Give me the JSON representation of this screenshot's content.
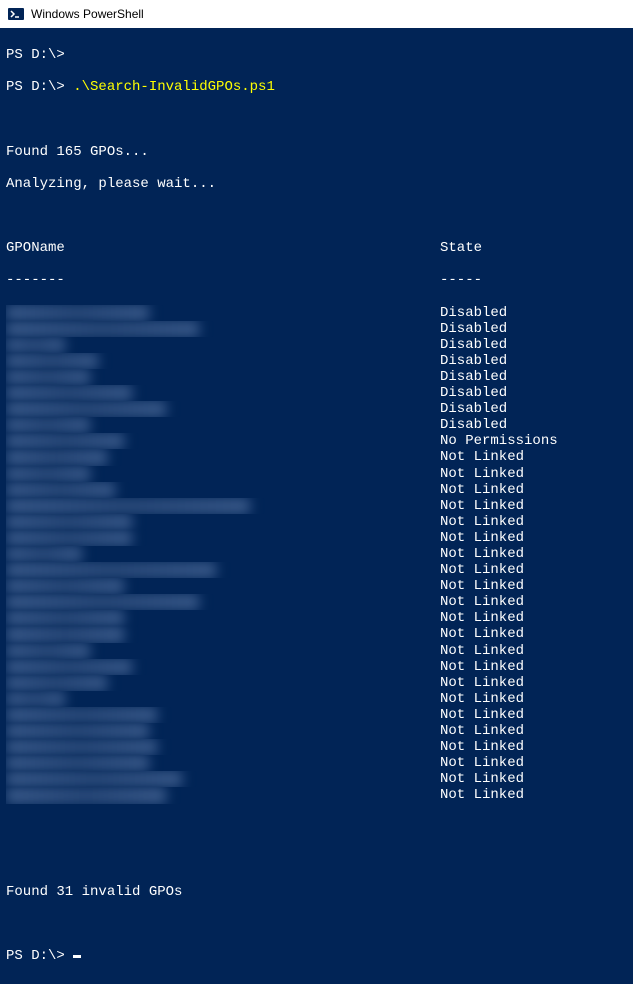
{
  "window": {
    "title": "Windows PowerShell"
  },
  "lines": {
    "prompt1_path": "PS D:\\>",
    "prompt2_path": "PS D:\\>",
    "command": ".\\Search-InvalidGPOs.ps1",
    "found": "Found 165 GPOs...",
    "analyzing": "Analyzing, please wait...",
    "header_name": "GPOName",
    "header_state": "State",
    "divider_name": "-------",
    "divider_state": "-----",
    "summary": "Found 31 invalid GPOs",
    "prompt3_path": "PS D:\\>"
  },
  "rows": [
    {
      "name_stub": "xxxxxx xxxxx xxxx",
      "state": "Disabled"
    },
    {
      "name_stub": "xxxxxxxxxx xxxx xxxxxxx",
      "state": "Disabled"
    },
    {
      "name_stub": "xx xxxx",
      "state": "Disabled"
    },
    {
      "name_stub": "xxx xxxxxxx",
      "state": "Disabled"
    },
    {
      "name_stub": "xxxx xxxxx",
      "state": "Disabled"
    },
    {
      "name_stub": "xxxxxxxxx xxxxx",
      "state": "Disabled"
    },
    {
      "name_stub": "xxxxx xxx xxxxxxxxx",
      "state": "Disabled"
    },
    {
      "name_stub": "xxxx xxxxx",
      "state": "Disabled"
    },
    {
      "name_stub": "xxxxxxxxx xxxx",
      "state": "No Permissions"
    },
    {
      "name_stub": "xxxxxxxxxxxx",
      "state": "Not Linked"
    },
    {
      "name_stub": "xx xxxxxxx",
      "state": "Not Linked"
    },
    {
      "name_stub": "xx xxx xxxxxx",
      "state": "Not Linked"
    },
    {
      "name_stub": "xxx xxxxxxxxx xxxx xxx xxxxxx",
      "state": "Not Linked"
    },
    {
      "name_stub": "xxx xxxxx xxxxx",
      "state": "Not Linked"
    },
    {
      "name_stub": "xxx xxxx xxxxxx",
      "state": "Not Linked"
    },
    {
      "name_stub": "xxx xxxxx",
      "state": "Not Linked"
    },
    {
      "name_stub": "xx xxxxx xxxxx xxxxx xxxx",
      "state": "Not Linked"
    },
    {
      "name_stub": "xxxxx xxx xxxx",
      "state": "Not Linked"
    },
    {
      "name_stub": "xxx xxxx xxxxxxxxx xxxx",
      "state": "Not Linked"
    },
    {
      "name_stub": "xxx xxxxx xxxx",
      "state": "Not Linked"
    },
    {
      "name_stub": "xx xxxx xxxxxx",
      "state": "Not Linked"
    },
    {
      "name_stub": "xx xxx xxx",
      "state": "Not Linked"
    },
    {
      "name_stub": "xxx xxxxxx xxxx",
      "state": "Not Linked"
    },
    {
      "name_stub": "x xxxx xxxxx",
      "state": "Not Linked"
    },
    {
      "name_stub": "x xxxxx",
      "state": "Not Linked"
    },
    {
      "name_stub": "xxxx xxxxxxxxx xxx",
      "state": "Not Linked"
    },
    {
      "name_stub": "xxxxx xxxxxxx xxx",
      "state": "Not Linked"
    },
    {
      "name_stub": "xxx xxxx xxxxxx xx",
      "state": "Not Linked"
    },
    {
      "name_stub": "xx xxxxx xxxxx xx",
      "state": "Not Linked"
    },
    {
      "name_stub": "xxx xxxxx xxxxxxx xxx",
      "state": "Not Linked"
    },
    {
      "name_stub": "xx xxxxx xxxxx xxxx",
      "state": "Not Linked"
    }
  ]
}
